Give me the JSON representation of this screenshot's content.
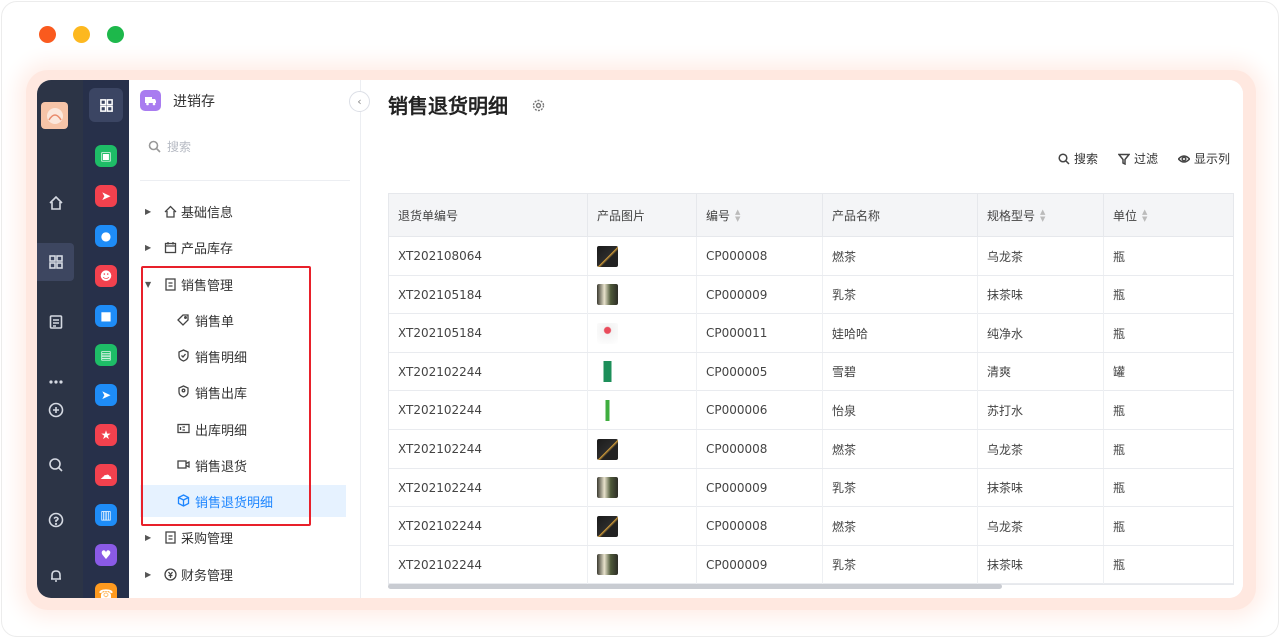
{
  "window": {
    "dot_colors": [
      "#fa5a1e",
      "#fdb81f",
      "#1db84b"
    ]
  },
  "rail": {
    "logo": "avatar-icon",
    "items": [
      "home-icon",
      "apps-grid-icon",
      "document-icon",
      "more-icon",
      "plus-circle-icon",
      "search-icon",
      "help-icon",
      "bell-icon"
    ]
  },
  "apps": {
    "items": [
      {
        "name": "app-green-doc",
        "color": "#1ebd67"
      },
      {
        "name": "app-red-send",
        "color": "#f2414e"
      },
      {
        "name": "app-blue-chat",
        "color": "#1e8cf7"
      },
      {
        "name": "app-red-user",
        "color": "#f2414e"
      },
      {
        "name": "app-blue-truck",
        "color": "#1e8cf7"
      },
      {
        "name": "app-green-ticket",
        "color": "#1ebd67"
      },
      {
        "name": "app-blue-send",
        "color": "#1e8cf7"
      },
      {
        "name": "app-red-star",
        "color": "#f2414e"
      },
      {
        "name": "app-red-cloud",
        "color": "#f2414e"
      },
      {
        "name": "app-blue-print",
        "color": "#1e8cf7"
      },
      {
        "name": "app-purple-heart",
        "color": "#8a5ae6"
      },
      {
        "name": "app-orange-phone",
        "color": "#ff9a1f"
      }
    ]
  },
  "nav": {
    "module_title": "进销存",
    "search_placeholder": "搜索",
    "groups": [
      {
        "label": "基础信息",
        "icon": "home-icon"
      },
      {
        "label": "产品库存",
        "icon": "calendar-icon"
      },
      {
        "label": "销售管理",
        "icon": "file-icon"
      },
      {
        "label": "采购管理",
        "icon": "file-icon"
      },
      {
        "label": "财务管理",
        "icon": "money-icon"
      }
    ],
    "sales_children": [
      {
        "label": "销售单",
        "icon": "tag-icon"
      },
      {
        "label": "销售明细",
        "icon": "shield-icon"
      },
      {
        "label": "销售出库",
        "icon": "shield-user-icon"
      },
      {
        "label": "出库明细",
        "icon": "box-id-icon"
      },
      {
        "label": "销售退货",
        "icon": "video-icon"
      },
      {
        "label": "销售退货明细",
        "icon": "cube-icon"
      }
    ],
    "active_item": "销售退货明细",
    "highlight_color": "#e8202a",
    "accent": "#1e86ff"
  },
  "main": {
    "title": "销售退货明细",
    "tools": {
      "search": "搜索",
      "filter": "过滤",
      "columns": "显示列"
    }
  },
  "table": {
    "columns": [
      "退货单编号",
      "产品图片",
      "编号",
      "产品名称",
      "规格型号",
      "单位"
    ],
    "sortable": [
      false,
      false,
      true,
      false,
      true,
      true
    ],
    "rows": [
      {
        "no": "XT202108064",
        "img": "dark-bottle",
        "code": "CP000008",
        "name": "燃茶",
        "spec": "乌龙茶",
        "unit": "瓶"
      },
      {
        "no": "XT202105184",
        "img": "milk-tea",
        "code": "CP000009",
        "name": "乳茶",
        "spec": "抹茶味",
        "unit": "瓶"
      },
      {
        "no": "XT202105184",
        "img": "water-bottle",
        "code": "CP000011",
        "name": "娃哈哈",
        "spec": "纯净水",
        "unit": "瓶"
      },
      {
        "no": "XT202102244",
        "img": "soda-can",
        "code": "CP000005",
        "name": "雪碧",
        "spec": "清爽",
        "unit": "罐"
      },
      {
        "no": "XT202102244",
        "img": "green-bottle",
        "code": "CP000006",
        "name": "怡泉",
        "spec": "苏打水",
        "unit": "瓶"
      },
      {
        "no": "XT202102244",
        "img": "dark-bottle",
        "code": "CP000008",
        "name": "燃茶",
        "spec": "乌龙茶",
        "unit": "瓶"
      },
      {
        "no": "XT202102244",
        "img": "milk-tea",
        "code": "CP000009",
        "name": "乳茶",
        "spec": "抹茶味",
        "unit": "瓶"
      },
      {
        "no": "XT202102244",
        "img": "dark-bottle",
        "code": "CP000008",
        "name": "燃茶",
        "spec": "乌龙茶",
        "unit": "瓶"
      },
      {
        "no": "XT202102244",
        "img": "milk-tea",
        "code": "CP000009",
        "name": "乳茶",
        "spec": "抹茶味",
        "unit": "瓶"
      }
    ]
  }
}
